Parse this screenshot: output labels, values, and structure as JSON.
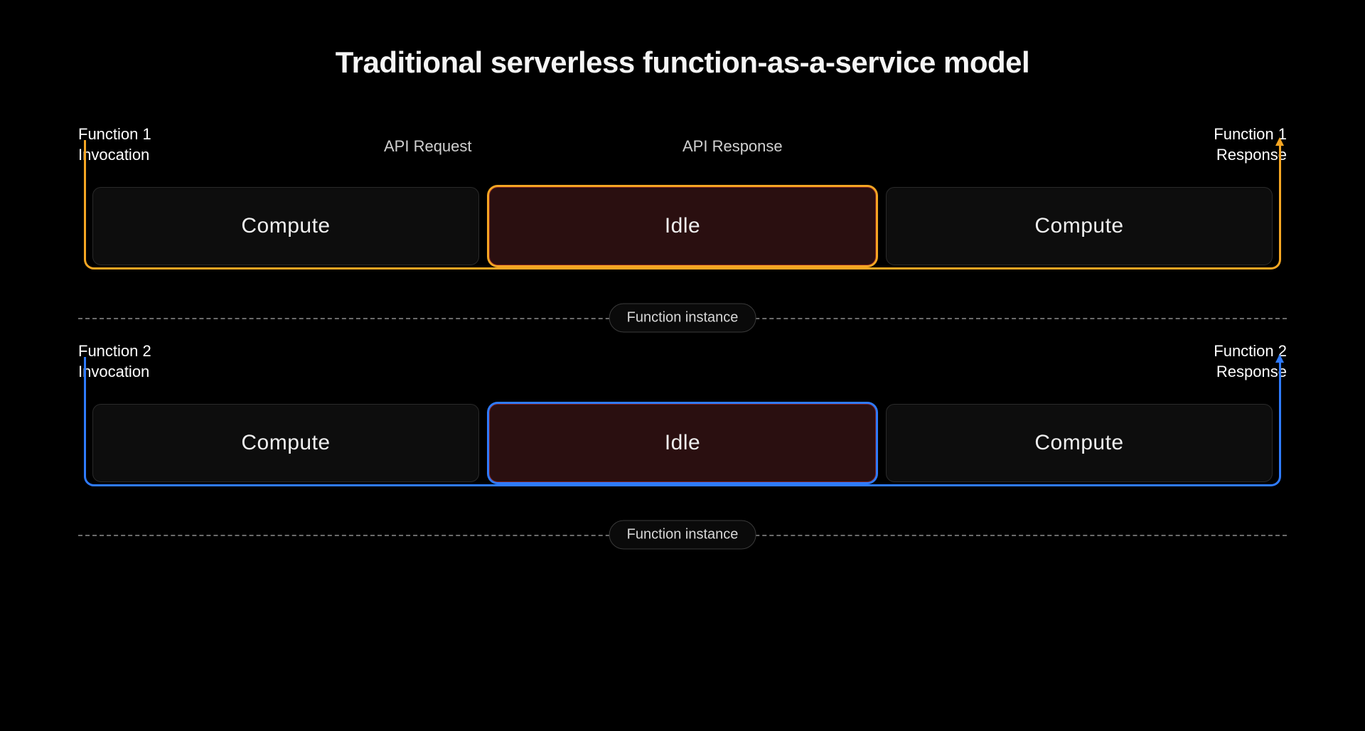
{
  "title": "Traditional serverless function-as-a-service model",
  "midLabels": {
    "request": "API Request",
    "response": "API Response"
  },
  "dividerLabel": "Function instance",
  "colors": {
    "lane1": "#f5a623",
    "lane2": "#2f7bff",
    "idleFill": "#2a0f10",
    "idleBorder": "#7a1f1f"
  },
  "lanes": [
    {
      "id": "function-1",
      "invocationLabel": "Function 1\nInvocation",
      "responseLabel": "Function 1\nResponse",
      "accent": "orange",
      "segments": [
        {
          "kind": "compute",
          "label": "Compute"
        },
        {
          "kind": "idle",
          "label": "Idle"
        },
        {
          "kind": "compute",
          "label": "Compute"
        }
      ]
    },
    {
      "id": "function-2",
      "invocationLabel": "Function 2\nInvocation",
      "responseLabel": "Function 2\nResponse",
      "accent": "blue",
      "segments": [
        {
          "kind": "compute",
          "label": "Compute"
        },
        {
          "kind": "idle",
          "label": "Idle"
        },
        {
          "kind": "compute",
          "label": "Compute"
        }
      ]
    }
  ]
}
